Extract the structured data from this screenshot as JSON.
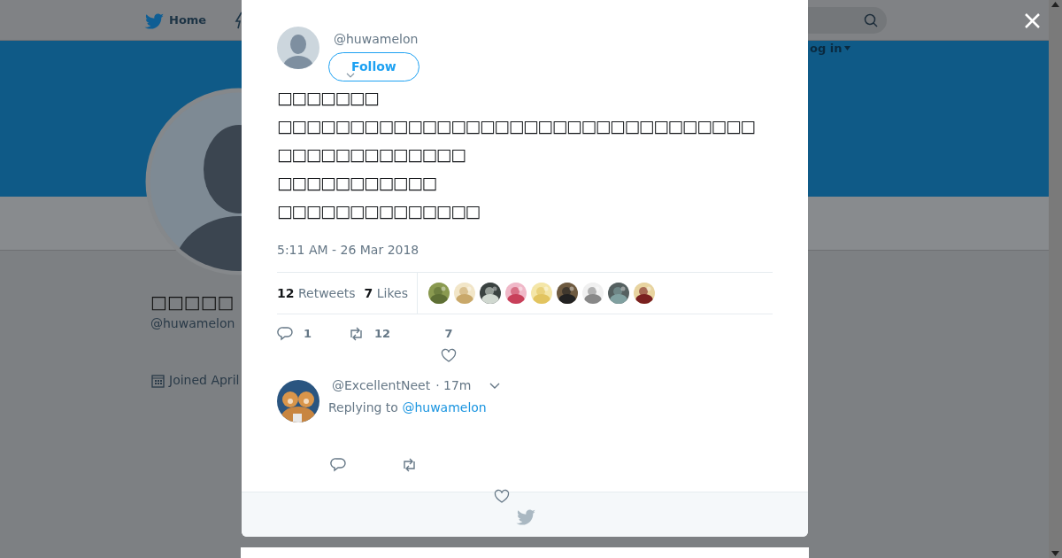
{
  "background_page": {
    "nav": {
      "home": "Home",
      "login": "og in"
    },
    "profile": {
      "name": "□□□□□",
      "handle": "@huwamelon",
      "joined": "Joined April"
    }
  },
  "tweet": {
    "handle": "@huwamelon",
    "follow": "Follow",
    "lines": [
      "□□□□□□□",
      "□□□□□□□□□□□□□□□□□□□□□□□□□□□□□□□□□",
      "□□□□□□□□□□□□□",
      "□□□□□□□□□□□",
      "□□□□□□□□□□□□□□"
    ],
    "timestamp": "5:11 AM - 26 Mar 2018",
    "stats": [
      {
        "count": "12",
        "label": "Retweets"
      },
      {
        "count": "7",
        "label": "Likes"
      }
    ],
    "actions": [
      {
        "kind": "reply",
        "count": "1"
      },
      {
        "kind": "retweet",
        "count": "12"
      },
      {
        "kind": "like",
        "count": "7"
      }
    ]
  },
  "reply": {
    "handle": "@ExcellentNeet",
    "time": "· 17m",
    "replying_to": "Replying to",
    "mention": "@huwamelon"
  }
}
